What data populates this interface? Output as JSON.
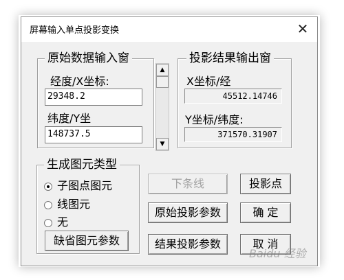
{
  "window": {
    "title": "屏幕输入单点投影变换",
    "close_glyph": "✕"
  },
  "input_group": {
    "label": "原始数据输入窗",
    "x_label": "经度/X坐标:",
    "x_value": "29348.2",
    "y_label": "纬度/Y坐",
    "y_value": "148737.5"
  },
  "scrollbar": {
    "up": "▲",
    "down": "▼"
  },
  "output_group": {
    "label": "投影结果输出窗",
    "x_label": "X坐标/经",
    "x_value": "45512.14746",
    "y_label": "Y坐标/纬度:",
    "y_value": "371570.31907"
  },
  "element_type_group": {
    "label": "生成图元类型",
    "options": [
      "子图点图元",
      "线图元",
      "无"
    ],
    "selected": "子图点图元"
  },
  "buttons": {
    "default_params": "缺省图元参数",
    "next_line": "下条线",
    "project": "投影点",
    "source_params": "原始投影参数",
    "ok": "确  定",
    "result_params": "结果投影参数",
    "cancel": "取  消"
  },
  "watermark": "Baidu 经验"
}
